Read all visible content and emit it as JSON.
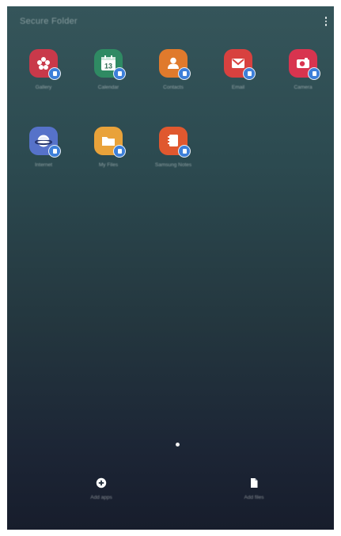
{
  "header": {
    "title": "Secure Folder",
    "more_icon": "more-vert-icon"
  },
  "apps": [
    {
      "label": "Gallery",
      "icon": "gallery-icon",
      "color": "#c9394a"
    },
    {
      "label": "Calendar",
      "icon": "calendar-icon",
      "color": "#2f8a63",
      "date": "13"
    },
    {
      "label": "Contacts",
      "icon": "contacts-icon",
      "color": "#e07a2c"
    },
    {
      "label": "Email",
      "icon": "email-icon",
      "color": "#d8413f"
    },
    {
      "label": "Camera",
      "icon": "camera-icon",
      "color": "#d8344f"
    },
    {
      "label": "Internet",
      "icon": "internet-icon",
      "color": "#5672c9"
    },
    {
      "label": "My Files",
      "icon": "folder-icon",
      "color": "#e9a23a"
    },
    {
      "label": "Samsung Notes",
      "icon": "notes-icon",
      "color": "#e0582f"
    }
  ],
  "pager": {
    "current": 1,
    "total": 1
  },
  "actions": {
    "add_apps": {
      "label": "Add apps",
      "icon": "add-circle-icon"
    },
    "add_files": {
      "label": "Add files",
      "icon": "file-icon"
    }
  },
  "colors": {
    "badge": "#3d7fd9",
    "background_top": "#35555a",
    "background_bottom": "#171d2c"
  }
}
